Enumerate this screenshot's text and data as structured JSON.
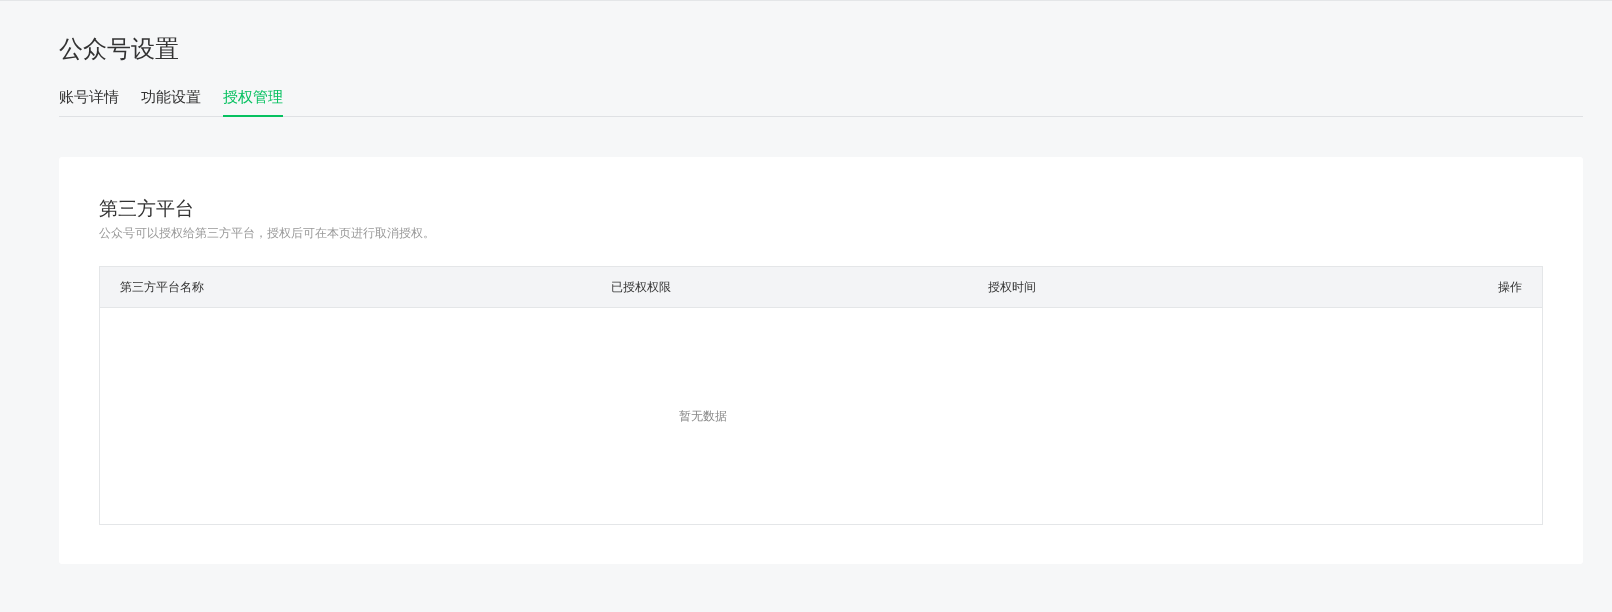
{
  "page": {
    "title": "公众号设置"
  },
  "tabs": [
    {
      "label": "账号详情",
      "selected": false
    },
    {
      "label": "功能设置",
      "selected": false
    },
    {
      "label": "授权管理",
      "selected": true
    }
  ],
  "section": {
    "title": "第三方平台",
    "description": "公众号可以授权给第三方平台，授权后可在本页进行取消授权。"
  },
  "table": {
    "columns": [
      "第三方平台名称",
      "已授权权限",
      "授权时间",
      "操作"
    ],
    "empty_text": "暂无数据"
  }
}
